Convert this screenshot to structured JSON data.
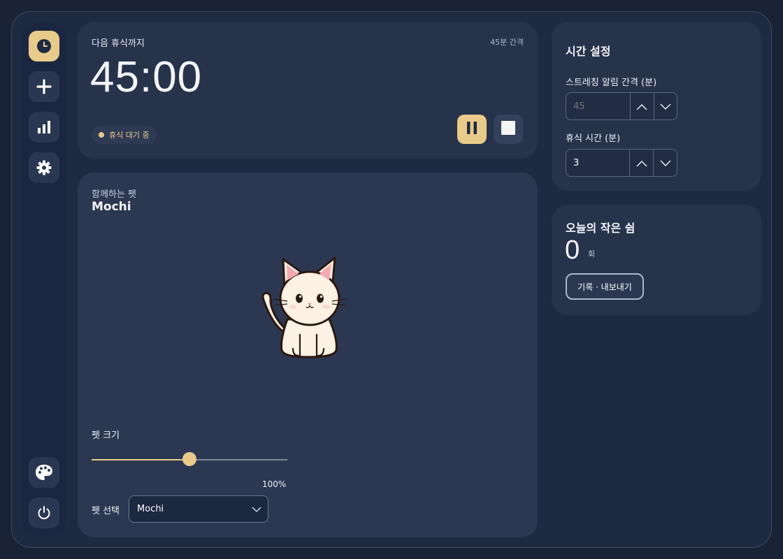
{
  "sidebar": {
    "items": [
      {
        "name": "timer",
        "icon": "clock-icon"
      },
      {
        "name": "add",
        "icon": "plus-icon"
      },
      {
        "name": "stats",
        "icon": "bar-chart-icon"
      },
      {
        "name": "settings",
        "icon": "gear-icon"
      }
    ],
    "bottom": [
      {
        "name": "theme",
        "icon": "palette-icon"
      },
      {
        "name": "power",
        "icon": "power-icon"
      }
    ],
    "active": "timer"
  },
  "timer": {
    "title": "다음 휴식까지",
    "interval_badge": "45분 간격",
    "time": "45:00",
    "status": "휴식 대기 중"
  },
  "pet": {
    "subtitle": "함께하는 펫",
    "name": "Mochi",
    "size_label": "펫 크기",
    "size_value_text": "100%",
    "size_slider_fraction": 0.5,
    "select_label": "펫 선택",
    "selected": "Mochi"
  },
  "settings": {
    "title": "시간 설정",
    "interval_label": "스트레칭 알림 간격 (분)",
    "interval_placeholder": "45",
    "break_label": "휴식 시간 (분)",
    "break_value": "3"
  },
  "today": {
    "title": "오늘의 작은 쉼",
    "count": "0",
    "unit": "회",
    "export_label": "기록 · 내보내기"
  },
  "colors": {
    "accent": "#e8cb8a",
    "background": "#1a2336",
    "card": "#27324b"
  }
}
